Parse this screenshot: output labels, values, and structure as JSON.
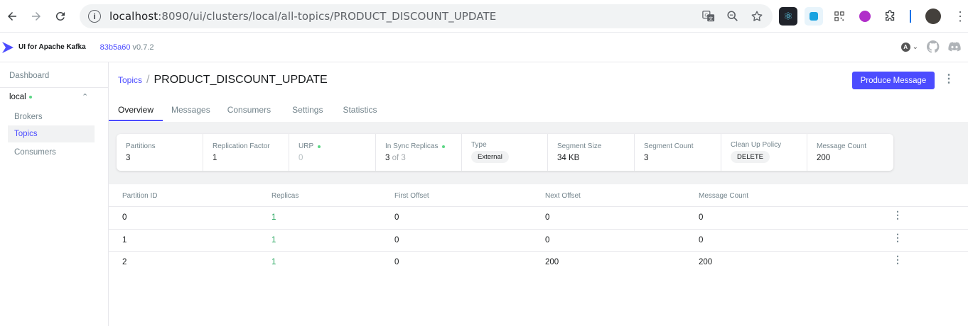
{
  "browser": {
    "url_host": "localhost",
    "url_path": ":8090/ui/clusters/local/all-topics/PRODUCT_DISCOUNT_UPDATE"
  },
  "header": {
    "brand": "UI for Apache Kafka",
    "commit": "83b5a60",
    "version": "v0.7.2",
    "user_initial": "A"
  },
  "sidebar": {
    "dashboard": "Dashboard",
    "cluster": "local",
    "items": [
      {
        "label": "Brokers",
        "active": false
      },
      {
        "label": "Topics",
        "active": true
      },
      {
        "label": "Consumers",
        "active": false
      }
    ]
  },
  "breadcrumb": {
    "parent": "Topics",
    "separator": "/",
    "title": "PRODUCT_DISCOUNT_UPDATE"
  },
  "actions": {
    "produce_label": "Produce Message"
  },
  "tabs": [
    {
      "label": "Overview",
      "active": true
    },
    {
      "label": "Messages",
      "active": false
    },
    {
      "label": "Consumers",
      "active": false
    },
    {
      "label": "Settings",
      "active": false
    },
    {
      "label": "Statistics",
      "active": false
    }
  ],
  "metrics": {
    "partitions": {
      "label": "Partitions",
      "value": "3"
    },
    "replication": {
      "label": "Replication Factor",
      "value": "1"
    },
    "urp": {
      "label": "URP",
      "value": "0"
    },
    "in_sync": {
      "label": "In Sync Replicas",
      "value": "3",
      "of": "of 3"
    },
    "type": {
      "label": "Type",
      "value": "External"
    },
    "segment_size": {
      "label": "Segment Size",
      "value": "34 KB"
    },
    "segment_count": {
      "label": "Segment Count",
      "value": "3"
    },
    "cleanup": {
      "label": "Clean Up Policy",
      "value": "DELETE"
    },
    "message_count": {
      "label": "Message Count",
      "value": "200"
    }
  },
  "table": {
    "headers": [
      "Partition ID",
      "Replicas",
      "First Offset",
      "Next Offset",
      "Message Count"
    ],
    "rows": [
      [
        "0",
        "1",
        "0",
        "0",
        "0"
      ],
      [
        "1",
        "1",
        "0",
        "0",
        "0"
      ],
      [
        "2",
        "1",
        "0",
        "200",
        "200"
      ]
    ]
  },
  "colors": {
    "accent": "#4c4cff",
    "green": "#22a55b",
    "muted": "#73848c"
  }
}
